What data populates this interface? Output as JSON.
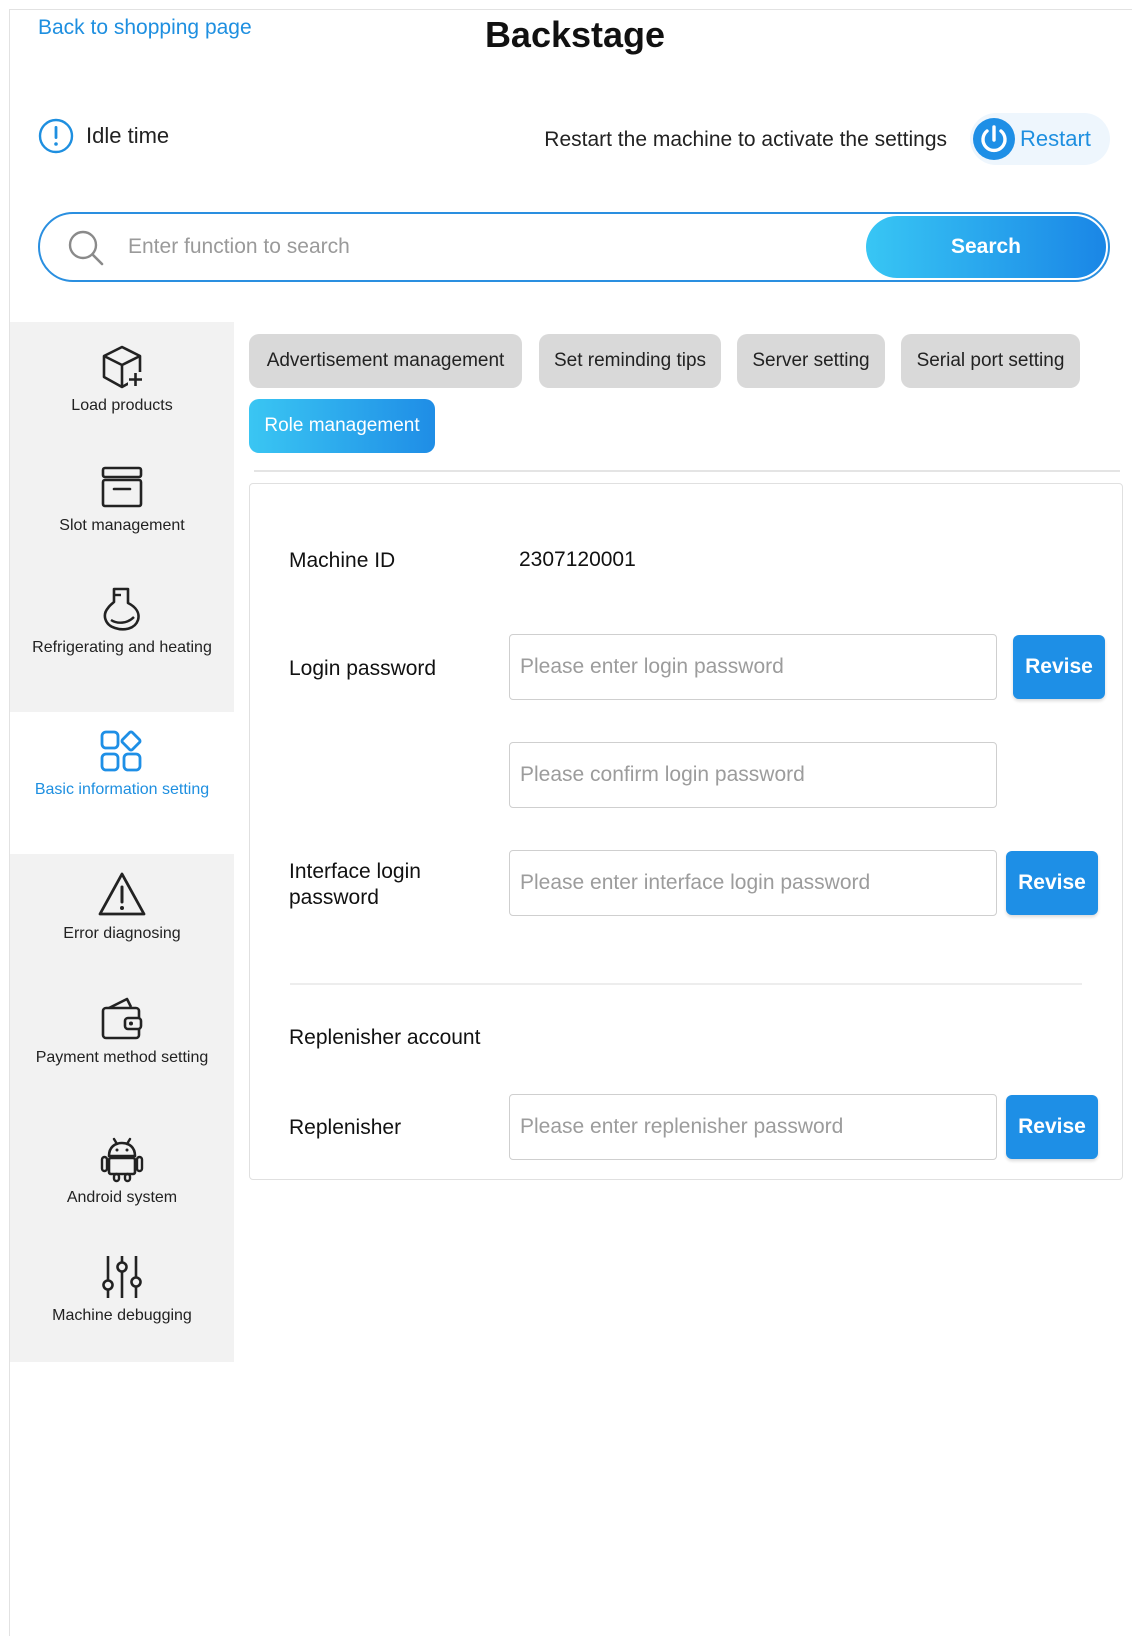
{
  "header": {
    "back_link": "Back to shopping page",
    "title": "Backstage",
    "idle_label": "Idle time",
    "restart_hint": "Restart the machine to activate the settings",
    "restart_label": "Restart"
  },
  "search": {
    "placeholder": "Enter function to search",
    "button_label": "Search"
  },
  "sidebar": {
    "items": [
      {
        "label": "Load products",
        "icon": "box-add-icon"
      },
      {
        "label": "Slot management",
        "icon": "drawer-icon"
      },
      {
        "label": "Refrigerating and heating",
        "icon": "flask-icon"
      },
      {
        "label": "Basic information setting",
        "icon": "grid-icon",
        "active": true
      },
      {
        "label": "Error diagnosing",
        "icon": "warning-icon"
      },
      {
        "label": "Payment method setting",
        "icon": "wallet-icon"
      },
      {
        "label": "Android system",
        "icon": "android-icon"
      },
      {
        "label": "Machine debugging",
        "icon": "sliders-icon"
      }
    ]
  },
  "tabs": [
    {
      "label": "Advertisement management"
    },
    {
      "label": "Set reminding tips"
    },
    {
      "label": "Server setting"
    },
    {
      "label": "Serial port setting"
    },
    {
      "label": "Role management",
      "active": true
    }
  ],
  "form": {
    "machine_id_label": "Machine ID",
    "machine_id_value": "2307120001",
    "login_password_label": "Login password",
    "login_password_placeholder": "Please enter login password",
    "login_password_confirm_placeholder": "Please confirm login password",
    "interface_login_label": "Interface login password",
    "interface_login_placeholder": "Please enter interface login password",
    "replenisher_section_title": "Replenisher account",
    "replenisher_label": "Replenisher",
    "replenisher_placeholder": "Please enter replenisher password",
    "revise_label": "Revise"
  },
  "colors": {
    "accent": "#1e8fe6",
    "link": "#1e8fe0",
    "sidebar_bg": "#f2f2f2",
    "tab_bg": "#d9d9d9"
  }
}
